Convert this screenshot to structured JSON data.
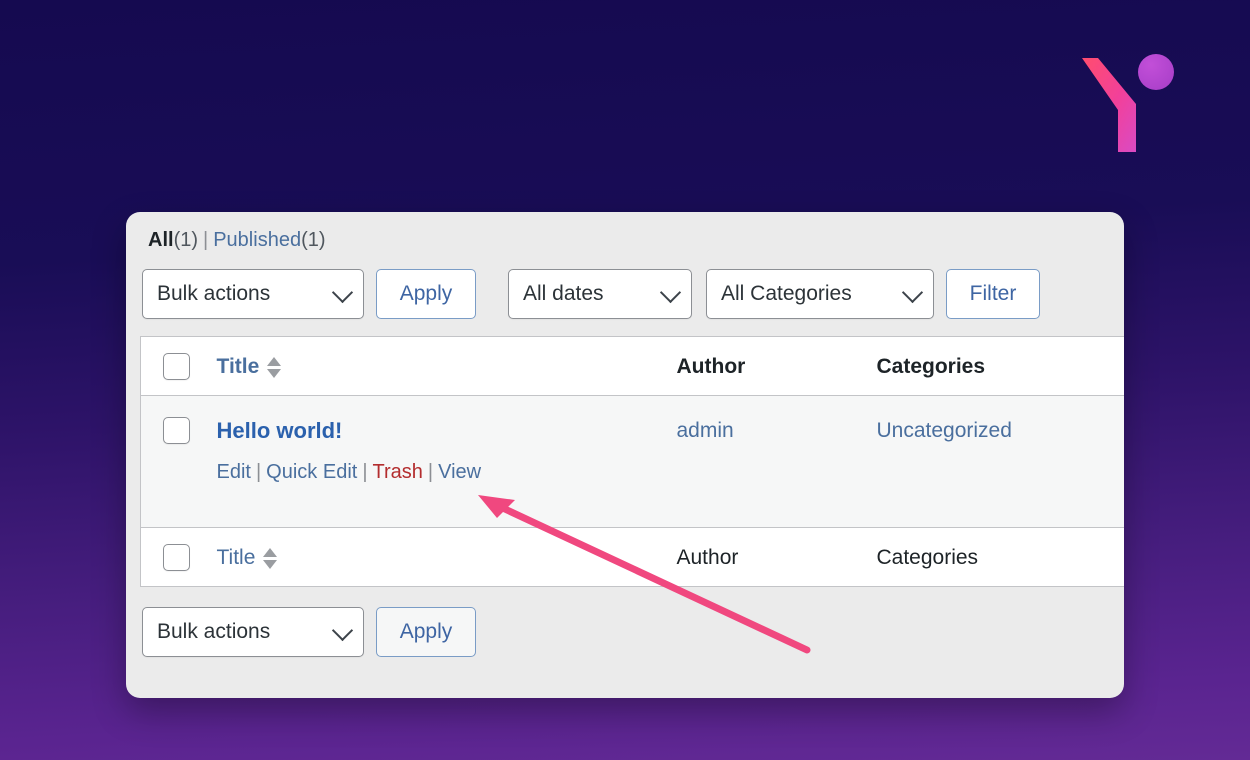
{
  "brand": {
    "logo_name": "y-mark-logo",
    "gradient_start": "#ff4d7e",
    "gradient_end": "#c44bd4",
    "dot_color": "#b84ad4"
  },
  "background": {
    "gradient_top": "#150a50",
    "gradient_bottom": "#632a95"
  },
  "views": {
    "all_label": "All",
    "all_count": "(1)",
    "separator": "|",
    "published_label": "Published",
    "published_count": "(1)"
  },
  "toolbar_top": {
    "bulk_actions_value": "Bulk actions",
    "apply_label": "Apply",
    "dates_value": "All dates",
    "categories_value": "All Categories",
    "filter_label": "Filter"
  },
  "table": {
    "columns": {
      "checkbox": "",
      "title": "Title",
      "author": "Author",
      "categories": "Categories"
    },
    "rows": [
      {
        "title": "Hello world!",
        "actions": {
          "edit": "Edit",
          "quick_edit": "Quick Edit",
          "trash": "Trash",
          "view": "View",
          "divider": "|"
        },
        "author": "admin",
        "categories": "Uncategorized"
      }
    ],
    "footer_columns": {
      "title": "Title",
      "author": "Author",
      "categories": "Categories"
    }
  },
  "toolbar_bottom": {
    "bulk_actions_value": "Bulk actions",
    "apply_label": "Apply"
  },
  "annotation": {
    "arrow_color": "#f0487f",
    "arrow_name": "pointer-arrow-to-trash"
  },
  "colors": {
    "link_blue": "#4a6f9e",
    "trash_red": "#b32d2e",
    "panel_bg": "#ebebeb"
  }
}
